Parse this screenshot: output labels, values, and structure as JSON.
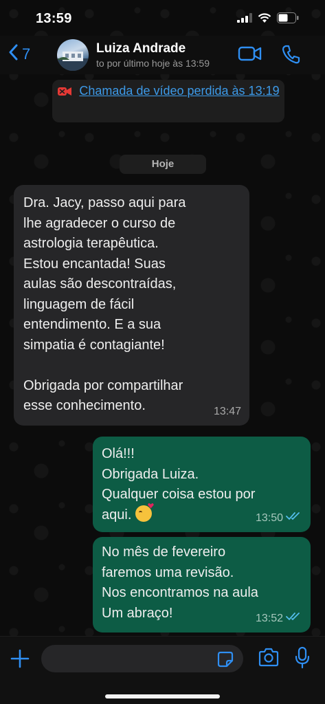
{
  "status_bar": {
    "time": "13:59"
  },
  "header": {
    "back_count": "7",
    "contact_name": "Luiza Andrade",
    "contact_status": "to por último hoje às 13:59"
  },
  "system": {
    "missed_call": "Chamada de vídeo perdida às 13:19",
    "date_chip": "Hoje"
  },
  "messages": [
    {
      "direction": "incoming",
      "text": "Dra. Jacy, passo aqui para\nlhe agradecer o curso de\nastrologia terapêutica.\nEstou encantada! Suas\naulas são descontraídas,\nlinguagem de fácil\nentendimento. E a sua\nsimpatia é contagiante!\n\nObrigada por compartilhar\nesse conhecimento.",
      "time": "13:47"
    },
    {
      "direction": "outgoing",
      "text": "Olá!!!\nObrigada Luiza.\nQualquer coisa estou por\naqui.",
      "emoji": "face-blowing-kiss",
      "time": "13:50",
      "status": "read"
    },
    {
      "direction": "outgoing",
      "text": "No mês de fevereiro\nfaremos uma revisão.\nNos encontramos na aula\nUm abraço!",
      "time": "13:52",
      "status": "read"
    }
  ],
  "input": {
    "placeholder": ""
  },
  "colors": {
    "accent": "#2f8ff3",
    "incoming_bubble": "#262628",
    "outgoing_bubble": "#0d5c45",
    "read_ticks": "#53bdeb",
    "missed_call_icon": "#e53935"
  }
}
